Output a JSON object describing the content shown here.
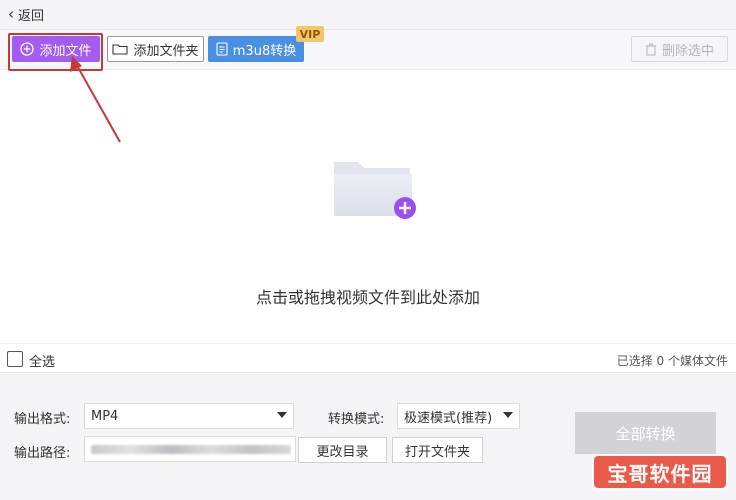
{
  "topbar": {
    "back_label": "返回"
  },
  "toolbar": {
    "add_file": "添加文件",
    "add_folder": "添加文件夹",
    "m3u8": "m3u8转换",
    "vip": "VIP",
    "delete_selected": "删除选中"
  },
  "dropzone": {
    "hint": "点击或拖拽视频文件到此处添加"
  },
  "selection": {
    "select_all": "全选",
    "count_text": "已选择 0 个媒体文件"
  },
  "settings": {
    "format_label": "输出格式:",
    "format_value": "MP4",
    "mode_label": "转换模式:",
    "mode_value": "极速模式(推荐)",
    "path_label": "输出路径:",
    "change_dir": "更改目录",
    "open_folder": "打开文件夹",
    "convert_all": "全部转换"
  },
  "watermark": {
    "text": "宝哥软件园"
  },
  "colors": {
    "accent_purple": "#a35bf0",
    "accent_blue": "#4a90e2",
    "highlight_red": "#c23b3b",
    "vip_gold": "#f6c56b"
  }
}
